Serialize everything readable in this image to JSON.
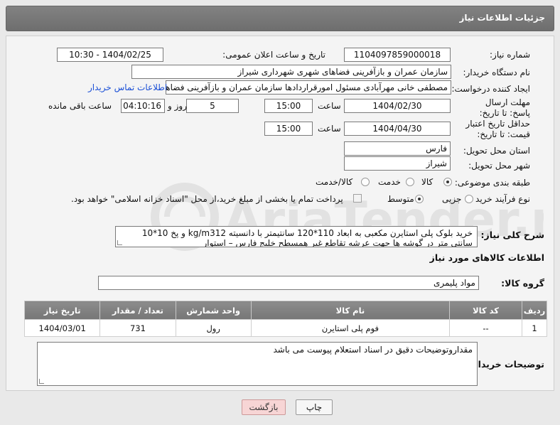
{
  "header": {
    "title": "جزئیات اطلاعات نیاز"
  },
  "form": {
    "need_number_label": "شماره نیاز:",
    "need_number": "1104097859000018",
    "announce_label": "تاریخ و ساعت اعلان عمومی:",
    "announce_value": "1404/02/25 - 10:30",
    "buyer_org_label": "نام دستگاه خریدار:",
    "buyer_org": "سازمان عمران و بازآفرینی فضاهای شهری شهرداری شیراز",
    "requester_label": "ایجاد کننده درخواست:",
    "requester": "مصطفی خانی مهرآبادی مسئول امورقراردادها سازمان عمران و بازآفرینی فضاهای",
    "buyer_contact_link": "اطلاعات تماس خریدار",
    "deadline_label": "مهلت ارسال پاسخ: تا تاریخ:",
    "deadline_date": "1404/02/30",
    "time_label": "ساعت",
    "deadline_time": "15:00",
    "days_value": "5",
    "days_label": "روز و",
    "remaining_time": "04:10:16",
    "remaining_label": "ساعت باقی مانده",
    "validity_label": "حداقل تاریخ اعتبار قیمت: تا تاریخ:",
    "validity_date": "1404/04/30",
    "validity_time": "15:00",
    "province_label": "استان محل تحویل:",
    "province": "فارس",
    "city_label": "شهر محل تحویل:",
    "city": "شیراز",
    "category_label": "طبقه بندی موضوعی:",
    "category_options": [
      "کالا",
      "خدمت",
      "کالا/خدمت"
    ],
    "process_label": "نوع فرآیند خرید :",
    "process_options": [
      "جزیی",
      "متوسط"
    ],
    "payment_note": "پرداخت تمام یا بخشی از مبلغ خرید،از محل \"اسناد خزانه اسلامی\" خواهد بود."
  },
  "description": {
    "label": "شرح کلی نیاز:",
    "text": "خرید بلوک پلی استایرن مکعبی به ابعاد 110*120 سانتیمتر با دانسیته kg/m312 و پخ 10*10 سانتی متر در گوشه ها جهت عرشه تقاطع غیر همسطح خلیج فارس – استوار"
  },
  "goods": {
    "section_title": "اطلاعات کالاهای مورد نیاز",
    "group_label": "گروه کالا:",
    "group_value": "مواد پلیمری",
    "columns": [
      "ردیف",
      "کد کالا",
      "نام کالا",
      "واحد شمارش",
      "تعداد / مقدار",
      "تاریخ نیاز"
    ],
    "rows": [
      [
        "1",
        "--",
        "فوم پلی استایرن",
        "رول",
        "731",
        "1404/03/01"
      ]
    ]
  },
  "notes": {
    "label": "توضیحات خریدار:",
    "text": "مقداروتوضیحات دقیق در اسناد استعلام پیوست می باشد"
  },
  "buttons": {
    "print": "چاپ",
    "back": "بازگشت"
  },
  "watermark": {
    "text": "AriaTender.neT"
  },
  "colors": {
    "header_bg": "#777777",
    "link": "#1a4fd6",
    "back_button_bg": "#f7d5d5"
  }
}
